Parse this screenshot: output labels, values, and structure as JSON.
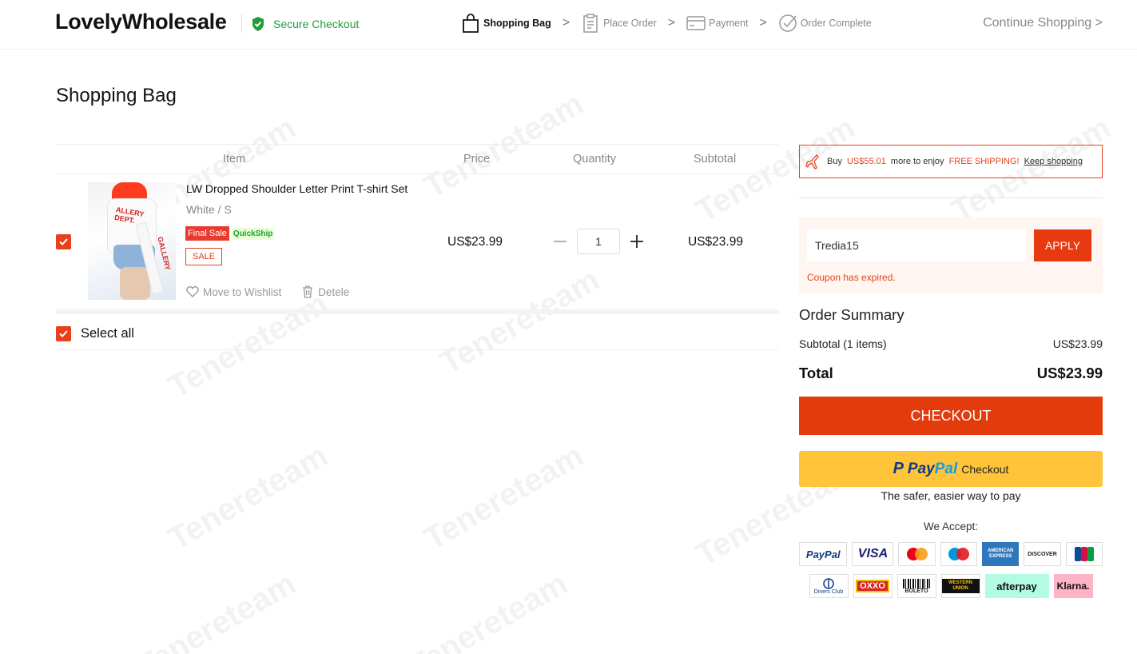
{
  "header": {
    "logo": "LovelyWholesale",
    "secure_label": "Secure Checkout",
    "steps": [
      {
        "label": "Shopping Bag",
        "icon": "bag-icon",
        "active": true
      },
      {
        "label": "Place Order",
        "icon": "clipboard-icon",
        "active": false
      },
      {
        "label": "Payment",
        "icon": "credit-card-icon",
        "active": false
      },
      {
        "label": "Order Complete",
        "icon": "check-circle-icon",
        "active": false
      }
    ],
    "step_arrow": ">",
    "continue_label": "Continue Shopping >"
  },
  "page_title": "Shopping Bag",
  "cart": {
    "columns": {
      "item": "Item",
      "price": "Price",
      "quantity": "Quantity",
      "subtotal": "Subtotal"
    },
    "items": [
      {
        "name": "LW Dropped Shoulder Letter Print T-shirt Set",
        "variant": "White / S",
        "badge_final": "Final Sale",
        "badge_quick": "QuickShip",
        "badge_sale": "SALE",
        "price": "US$23.99",
        "quantity": "1",
        "subtotal": "US$23.99",
        "wishlist_label": "Move to Wishlist",
        "delete_label": "Detele",
        "checked": true
      }
    ],
    "select_all_label": "Select all"
  },
  "sidebar": {
    "shipping": {
      "prefix": "Buy",
      "amount": "US$55.01",
      "middle": "more to enjoy",
      "free": "FREE SHIPPING!",
      "link": "Keep shopping"
    },
    "coupon": {
      "value": "Tredia15",
      "apply_label": "APPLY",
      "error": "Coupon has expired."
    },
    "summary": {
      "title": "Order Summary",
      "subtotal_label": "Subtotal (1 items)",
      "subtotal_value": "US$23.99",
      "total_label": "Total",
      "total_value": "US$23.99"
    },
    "checkout_label": "CHECKOUT",
    "paypal": {
      "pay": "Pay",
      "pal": "Pal",
      "checkout": "Checkout",
      "note": "The safer, easier way to pay"
    },
    "we_accept": "We Accept:",
    "payment_methods_row1": [
      "PayPal",
      "VISA",
      "Mastercard",
      "Maestro",
      "American Express",
      "Discover",
      "JCB"
    ],
    "payment_methods_row2": [
      "Diners Club",
      "OXXO",
      "Boleto",
      "Western Union",
      "afterpay",
      "Klarna."
    ],
    "card_labels": {
      "paypal": "PayPal",
      "visa": "VISA",
      "amex": "AMERICAN EXPRESS",
      "discover": "DISCOVER",
      "jcb": "JCB",
      "diners": "Diners Club",
      "oxxo": "OXXO",
      "boleto": "BOLETO",
      "wu": "WESTERN UNION",
      "afterpay": "afterpay",
      "klarna": "Klarna."
    }
  },
  "colors": {
    "accent": "#e8401c",
    "secure_green": "#1f9d3a",
    "paypal_yellow": "#ffc43a"
  }
}
